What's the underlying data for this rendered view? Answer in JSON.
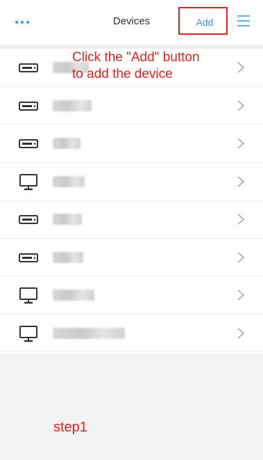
{
  "header": {
    "title": "Devices",
    "add_label": "Add",
    "more_icon": "more-dots-icon",
    "menu_icon": "list-menu-icon",
    "accent_color": "#3a8fd8"
  },
  "devices": [
    {
      "icon": "dvr-icon"
    },
    {
      "icon": "dvr-icon"
    },
    {
      "icon": "dvr-icon"
    },
    {
      "icon": "monitor-icon"
    },
    {
      "icon": "dvr-icon"
    },
    {
      "icon": "dvr-icon"
    },
    {
      "icon": "monitor-icon"
    },
    {
      "icon": "monitor-icon"
    }
  ],
  "annotation": {
    "text_line1": "Click the \"Add\" button",
    "text_line2": "to add the device",
    "step_label": "step1",
    "color": "#e02020"
  }
}
